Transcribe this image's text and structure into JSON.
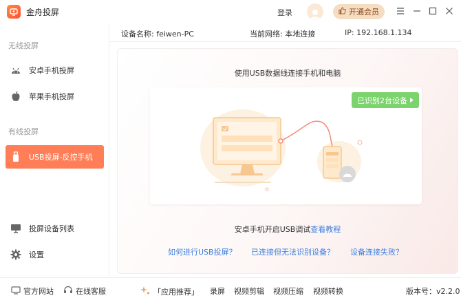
{
  "app": {
    "title": "金舟投屏"
  },
  "header": {
    "login": "登录",
    "vip": "开通会员"
  },
  "sidebar": {
    "wireless_label": "无线投屏",
    "android": "安卓手机投屏",
    "apple": "苹果手机投屏",
    "wired_label": "有线投屏",
    "usb": "USB投屏-反控手机",
    "device_list": "投屏设备列表",
    "settings": "设置"
  },
  "info": {
    "device_name": "设备名称: feiwen-PC",
    "network": "当前网络:  本地连接",
    "ip": "IP: 192.168.1.134"
  },
  "main": {
    "title": "使用USB数据线连接手机和电脑",
    "detected": "已识别2台设备",
    "hint_prefix": "安卓手机开启USB调试",
    "hint_link": "查看教程",
    "help1": "如何进行USB投屏？",
    "help2": "已连接但无法识别设备？",
    "help3": "设备连接失败？"
  },
  "bottom": {
    "website": "官方网站",
    "service": "在线客服",
    "recommend": "「应用推荐」",
    "record": "录屏",
    "video_edit": "视频剪辑",
    "video_compress": "视频压缩",
    "video_convert": "视频转换",
    "version": "版本号：v2.2.0"
  },
  "colors": {
    "accent": "#ff7e57",
    "link": "#3c7fe0",
    "badge": "#7bd36b"
  }
}
